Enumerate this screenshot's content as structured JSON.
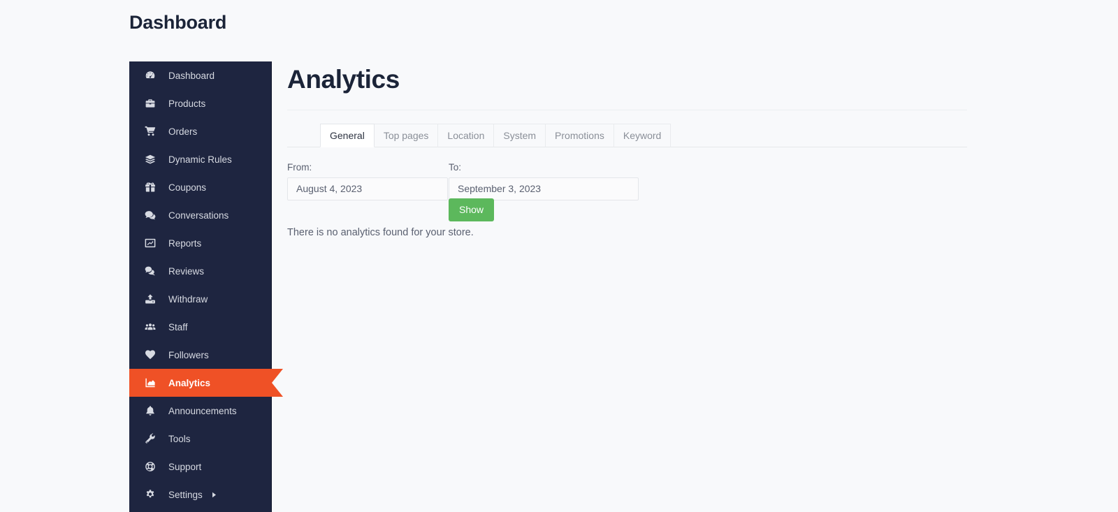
{
  "header": {
    "title": "Dashboard"
  },
  "sidebar": {
    "items": [
      {
        "label": "Dashboard",
        "icon": "tachometer-icon",
        "active": false,
        "submenu": false
      },
      {
        "label": "Products",
        "icon": "briefcase-icon",
        "active": false,
        "submenu": false
      },
      {
        "label": "Orders",
        "icon": "shopping-cart-icon",
        "active": false,
        "submenu": false
      },
      {
        "label": "Dynamic Rules",
        "icon": "layers-icon",
        "active": false,
        "submenu": false
      },
      {
        "label": "Coupons",
        "icon": "gift-icon",
        "active": false,
        "submenu": false
      },
      {
        "label": "Conversations",
        "icon": "comments-icon",
        "active": false,
        "submenu": false
      },
      {
        "label": "Reports",
        "icon": "chart-line-icon",
        "active": false,
        "submenu": false
      },
      {
        "label": "Reviews",
        "icon": "review-bubbles-icon",
        "active": false,
        "submenu": false
      },
      {
        "label": "Withdraw",
        "icon": "upload-icon",
        "active": false,
        "submenu": false
      },
      {
        "label": "Staff",
        "icon": "users-icon",
        "active": false,
        "submenu": false
      },
      {
        "label": "Followers",
        "icon": "heart-icon",
        "active": false,
        "submenu": false
      },
      {
        "label": "Analytics",
        "icon": "area-chart-icon",
        "active": true,
        "submenu": false
      },
      {
        "label": "Announcements",
        "icon": "bell-icon",
        "active": false,
        "submenu": false
      },
      {
        "label": "Tools",
        "icon": "wrench-icon",
        "active": false,
        "submenu": false
      },
      {
        "label": "Support",
        "icon": "lifebuoy-icon",
        "active": false,
        "submenu": false
      },
      {
        "label": "Settings",
        "icon": "gear-icon",
        "active": false,
        "submenu": true
      }
    ]
  },
  "main": {
    "title": "Analytics",
    "tabs": [
      {
        "label": "General",
        "active": true
      },
      {
        "label": "Top pages",
        "active": false
      },
      {
        "label": "Location",
        "active": false
      },
      {
        "label": "System",
        "active": false
      },
      {
        "label": "Promotions",
        "active": false
      },
      {
        "label": "Keyword",
        "active": false
      }
    ],
    "form": {
      "from_label": "From:",
      "from_value": "August 4, 2023",
      "to_label": "To:",
      "to_value": "September 3, 2023",
      "submit_label": "Show"
    },
    "empty_message": "There is no analytics found for your store."
  },
  "colors": {
    "sidebar_bg": "#1e2540",
    "accent_orange": "#ef5126",
    "submit_green": "#5cb85c",
    "page_bg": "#f8f9fb",
    "heading": "#1b2438"
  }
}
